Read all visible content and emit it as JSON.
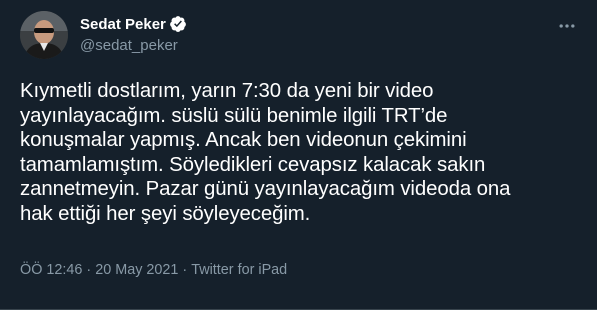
{
  "author": {
    "display_name": "Sedat Peker",
    "handle": "@sedat_peker",
    "verified": true
  },
  "tweet": {
    "text": "Kıymetli dostlarım, yarın 7:30 da yeni bir video\nyayınlayacağım. süslü sülü benimle ilgili TRT’de\nkonuşmalar yapmış. Ancak ben videonun çekimini\ntamamlamıştım. Söyledikleri cevapsız kalacak sakın\nzannetmeyin. Pazar günü yayınlayacağım videoda ona\nhak ettiği her şeyi söyleyeceğim.",
    "time": "ÖÖ 12:46",
    "separator": "·",
    "date": "20 May 2021",
    "source": "Twitter for iPad"
  },
  "icons": {
    "verified": "verified-badge-icon",
    "more": "more-horizontal-icon"
  },
  "colors": {
    "background": "#15202b",
    "text": "#ffffff",
    "secondary": "#8899a6",
    "verified": "#ffffff"
  }
}
